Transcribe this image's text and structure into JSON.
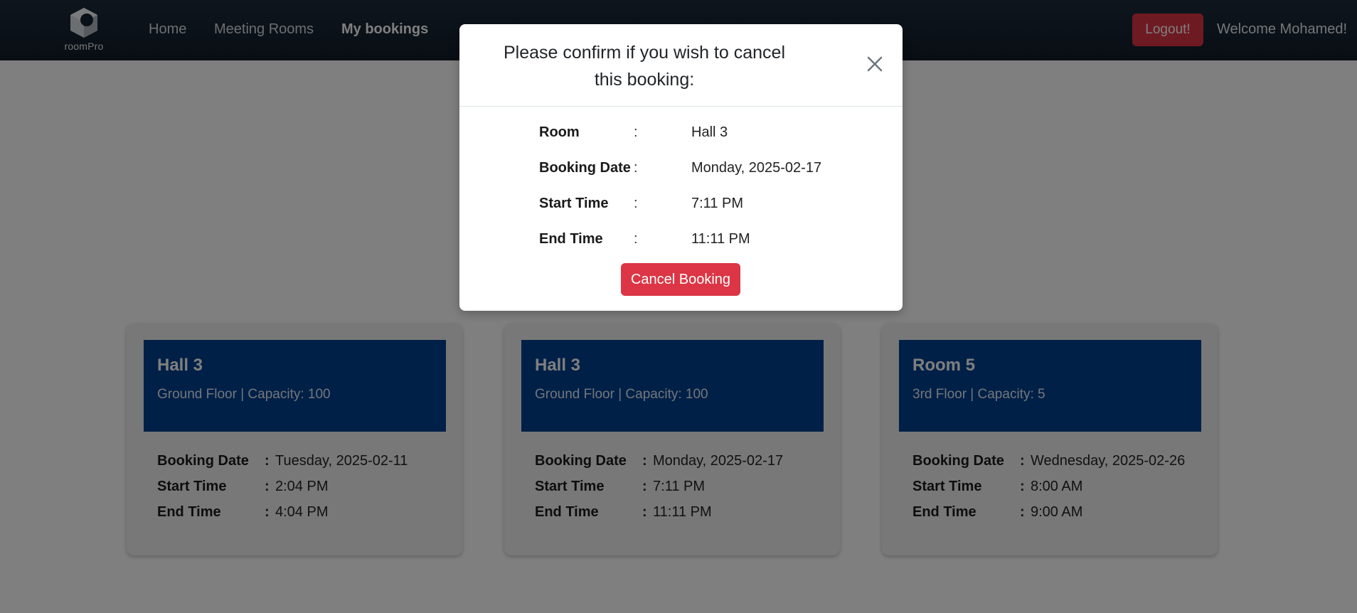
{
  "navbar": {
    "logo_text": "roomPro",
    "links": [
      {
        "label": "Home"
      },
      {
        "label": "Meeting Rooms"
      },
      {
        "label": "My bookings"
      }
    ],
    "logout_label": "Logout!",
    "welcome_text": "Welcome Mohamed!"
  },
  "bookings": [
    {
      "room": "Hall 3",
      "subtitle": "Ground Floor | Capacity: 100",
      "booking_date_label": "Booking Date",
      "booking_date": "Tuesday, 2025-02-11",
      "start_time_label": "Start Time",
      "start_time": "2:04 PM",
      "end_time_label": "End Time",
      "end_time": "4:04 PM"
    },
    {
      "room": "Hall 3",
      "subtitle": "Ground Floor | Capacity: 100",
      "booking_date_label": "Booking Date",
      "booking_date": "Monday, 2025-02-17",
      "start_time_label": "Start Time",
      "start_time": "7:11 PM",
      "end_time_label": "End Time",
      "end_time": "11:11 PM"
    },
    {
      "room": "Room 5",
      "subtitle": "3rd Floor | Capacity: 5",
      "booking_date_label": "Booking Date",
      "booking_date": "Wednesday, 2025-02-26",
      "start_time_label": "Start Time",
      "start_time": "8:00 AM",
      "end_time_label": "End Time",
      "end_time": "9:00 AM"
    }
  ],
  "modal": {
    "title": "Please confirm if you wish to cancel this booking:",
    "close_icon": "close-icon",
    "colon": ":",
    "rows": [
      {
        "label": "Room",
        "value": "Hall 3"
      },
      {
        "label": "Booking Date",
        "value": "Monday, 2025-02-17"
      },
      {
        "label": "Start Time",
        "value": "7:11 PM"
      },
      {
        "label": "End Time",
        "value": "11:11 PM"
      }
    ],
    "cancel_label": "Cancel Booking"
  },
  "colors": {
    "navbar_bg": "#15212e",
    "danger": "#dc3545",
    "card_header": "#00408f",
    "card_bg": "#f1f1f1",
    "backdrop": "rgba(0,0,0,0.5)"
  }
}
